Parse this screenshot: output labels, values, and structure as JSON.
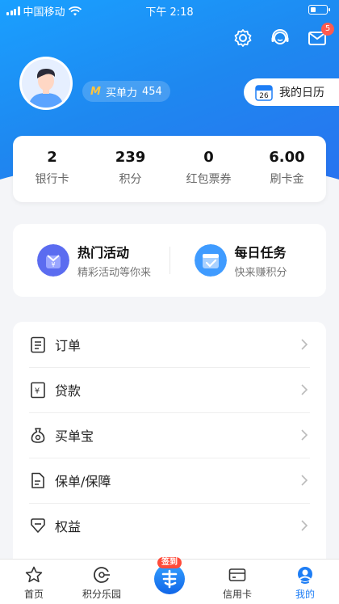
{
  "status_bar": {
    "carrier": "中国移动",
    "time": "下午 2:18"
  },
  "header": {
    "message_badge": "5"
  },
  "profile": {
    "power_label": "买单力",
    "power_value": "454",
    "calendar_label": "我的日历",
    "calendar_day": "26"
  },
  "stats": [
    {
      "value": "2",
      "label": "银行卡"
    },
    {
      "value": "239",
      "label": "积分"
    },
    {
      "value": "0",
      "label": "红包票券"
    },
    {
      "value": "6.00",
      "label": "刷卡金"
    }
  ],
  "promos": [
    {
      "title": "热门活动",
      "subtitle": "精彩活动等你来"
    },
    {
      "title": "每日任务",
      "subtitle": "快来赚积分"
    }
  ],
  "menu": [
    {
      "label": "订单",
      "icon": "order-icon"
    },
    {
      "label": "贷款",
      "icon": "loan-icon"
    },
    {
      "label": "买单宝",
      "icon": "money-bag-icon"
    },
    {
      "label": "保单/保障",
      "icon": "policy-icon"
    },
    {
      "label": "权益",
      "icon": "rights-icon"
    }
  ],
  "tabs": [
    {
      "label": "首页",
      "icon": "star-icon"
    },
    {
      "label": "积分乐园",
      "icon": "points-icon"
    },
    {
      "label": "",
      "icon": "checkin-icon",
      "tag": "签到"
    },
    {
      "label": "信用卡",
      "icon": "card-icon"
    },
    {
      "label": "我的",
      "icon": "profile-icon"
    }
  ],
  "colors": {
    "accent": "#1e7ef5",
    "hero": "#1aa0ff",
    "badge": "#ff5a4e"
  }
}
